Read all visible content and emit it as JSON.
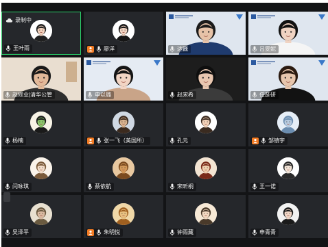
{
  "recording": {
    "label": "录制中",
    "icon": "cloud-record-icon"
  },
  "participants": [
    {
      "name": "王叶雨",
      "kind": "avatar",
      "skin": "#f3d2bd",
      "hair": "#202020",
      "bg": "#ffffff",
      "active": true
    },
    {
      "name": "廖洋",
      "kind": "avatar",
      "skin": "#f2d4c2",
      "hair": "#151515",
      "bg": "#ffffff",
      "host": true
    },
    {
      "name": "达巍",
      "kind": "video",
      "scene": "poster-man",
      "bg": "#dfe6ef",
      "shirt": "#1f3b6e",
      "skin": "#e7c3a8",
      "hair": "#1b1b1b"
    },
    {
      "name": "吕雯妮",
      "kind": "video",
      "scene": "poster-woman",
      "bg": "#dfe6ef",
      "shirt": "#f5f5f5",
      "skin": "#f0d3c2",
      "hair": "#111111"
    },
    {
      "name": "赵修业|清华公管",
      "kind": "video",
      "scene": "room-man",
      "bg": "#e9ded0",
      "shirt": "#2e2e2e",
      "skin": "#e2b999",
      "hair": "#191919"
    },
    {
      "name": "申以璐",
      "kind": "video",
      "scene": "poster-woman2",
      "bg": "#e5ebf3",
      "shirt": "#c9a488",
      "skin": "#f2d5c4",
      "hair": "#151515"
    },
    {
      "name": "赵宋希",
      "kind": "video",
      "scene": "dark-woman",
      "bg": "#1d1d1d",
      "shirt": "#3b3b3b",
      "skin": "#e9c7b0",
      "hair": "#0e0e0e"
    },
    {
      "name": "任彦研",
      "kind": "video",
      "scene": "poster-woman3",
      "bg": "#dfe6ef",
      "shirt": "#121212",
      "skin": "#e7c6ad",
      "hair": "#2a1a10"
    },
    {
      "name": "杨楠",
      "kind": "avatar",
      "skin": "#8cc66b",
      "hair": "#1a1a1a",
      "bg": "#f7f3e6"
    },
    {
      "name": "张一飞（美国所）",
      "kind": "avatar",
      "skin": "#d9b38f",
      "hair": "#3b2a1e",
      "bg": "#cfd8e3",
      "host": true
    },
    {
      "name": "孔元",
      "kind": "avatar",
      "skin": "#f4d3b9",
      "hair": "#3a2b20",
      "bg": "#ffffff"
    },
    {
      "name": "邹镇宇",
      "kind": "avatar",
      "skin": "#b8cbe0",
      "hair": "#6b8db0",
      "bg": "#e6eef7",
      "host": true
    },
    {
      "name": "闫咏琪",
      "kind": "avatar",
      "skin": "#f3ddc9",
      "hair": "#7a5a3a",
      "bg": "#faf3ea"
    },
    {
      "name": "蔡依航",
      "kind": "avatar",
      "skin": "#d49a5a",
      "hair": "#7a4a1f",
      "bg": "#e8c8a0"
    },
    {
      "name": "宋昕桐",
      "kind": "avatar",
      "skin": "#f0d0b0",
      "hair": "#7a2a1a",
      "bg": "#f3e4d2"
    },
    {
      "name": "王一诺",
      "kind": "avatar",
      "skin": "#f6e7da",
      "hair": "#2a2a2a",
      "bg": "#ffffff"
    },
    {
      "name": "吴泽平",
      "kind": "avatar",
      "skin": "#d9b9a0",
      "hair": "#6a5a40",
      "bg": "#e8e0d0"
    },
    {
      "name": "朱明悦",
      "kind": "avatar",
      "skin": "#e8c080",
      "hair": "#a06020",
      "bg": "#f0d8a8",
      "host": true
    },
    {
      "name": "钟雨藏",
      "kind": "avatar",
      "skin": "#f3d8c0",
      "hair": "#4a3a2a",
      "bg": "#f7e9d6"
    },
    {
      "name": "申青青",
      "kind": "avatar",
      "skin": "#f1d6c6",
      "hair": "#1a1a1a",
      "bg": "#f2f2f2"
    }
  ]
}
